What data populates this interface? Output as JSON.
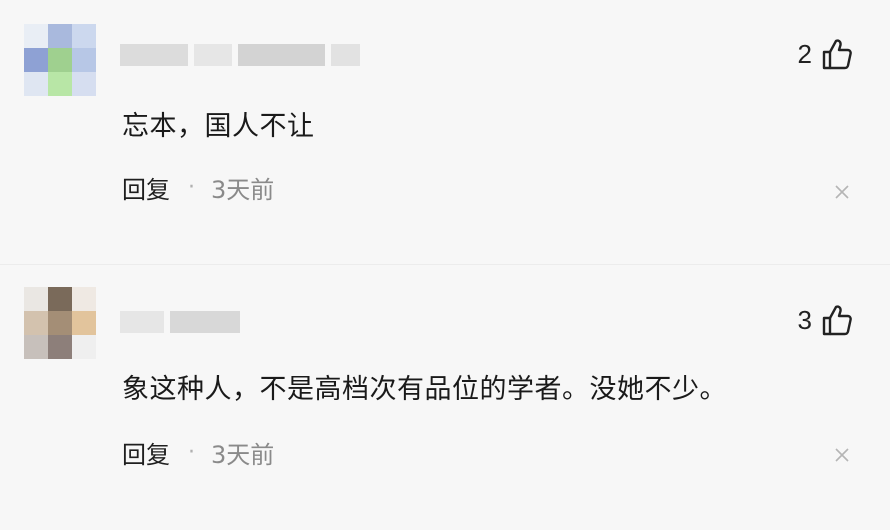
{
  "comments": [
    {
      "text": "忘本，国人不让",
      "like_count": "2",
      "reply_label": "回复",
      "separator": "·",
      "time": "3天前",
      "icons": {
        "like": "thumbs-up-icon",
        "close": "close-icon"
      }
    },
    {
      "text": "象这种人，不是高档次有品位的学者。没她不少。",
      "like_count": "3",
      "reply_label": "回复",
      "separator": "·",
      "time": "3天前",
      "icons": {
        "like": "thumbs-up-icon",
        "close": "close-icon"
      }
    }
  ],
  "colors": {
    "background": "#f7f7f7",
    "text": "#1a1a1a",
    "muted": "#8a8a8a"
  }
}
